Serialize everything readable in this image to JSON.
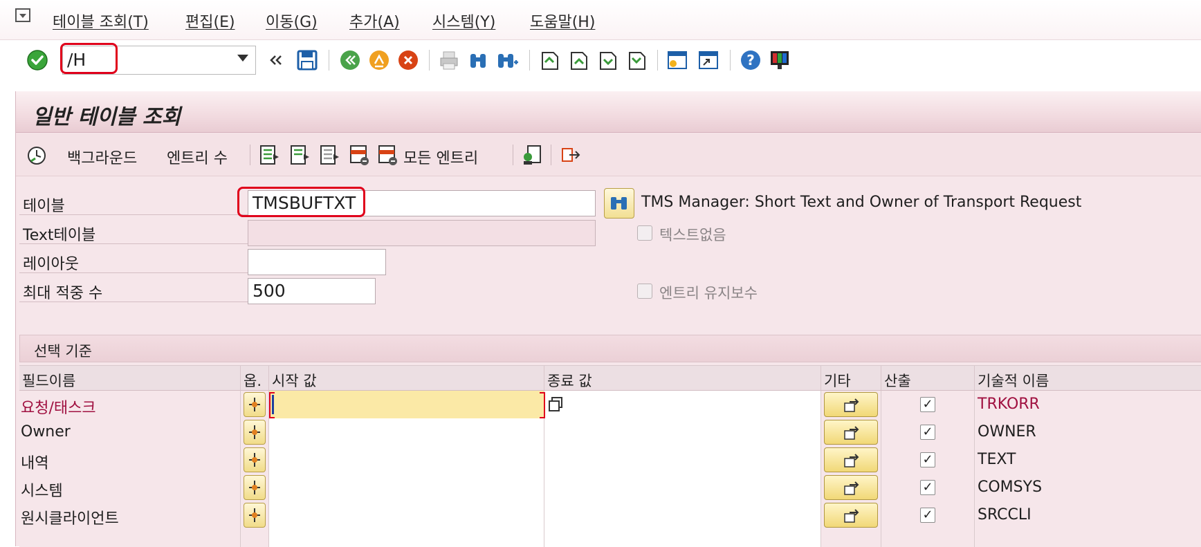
{
  "menu": {
    "items": [
      "테이블 조회(T)",
      "편집(E)",
      "이동(G)",
      "추가(A)",
      "시스템(Y)",
      "도움말(H)"
    ]
  },
  "toolbar": {
    "command_value": "/H",
    "icons": [
      "enter-icon",
      "back-double-icon",
      "save-icon",
      "back-icon",
      "exit-icon",
      "cancel-icon",
      "print-icon",
      "find-icon",
      "find-next-icon",
      "first-page-icon",
      "previous-page-icon",
      "next-page-icon",
      "last-page-icon",
      "create-session-icon",
      "shortcut-icon",
      "help-icon",
      "customize-layout-icon"
    ]
  },
  "page": {
    "title": "일반 테이블 조회"
  },
  "app_toolbar": {
    "background_label": "백그라운드",
    "entry_count_label": "엔트리 수",
    "all_entries_label": "모든 엔트리"
  },
  "form": {
    "table_label": "테이블",
    "table_value": "TMSBUFTXT",
    "table_description": "TMS Manager: Short Text and Owner of Transport Request",
    "text_table_label": "Text테이블",
    "text_table_value": "",
    "layout_label": "레이아웃",
    "layout_value": "",
    "max_hits_label": "최대 적중 수",
    "max_hits_value": "500",
    "no_text_label": "텍스트없음",
    "entry_maintenance_label": "엔트리 유지보수"
  },
  "selection": {
    "group_title": "선택 기준",
    "columns": [
      "필드이름",
      "옵.",
      "시작 값",
      "종료 값",
      "기타",
      "산출",
      "기술적 이름"
    ],
    "rows": [
      {
        "field": "요청/태스크",
        "from": "",
        "to": "",
        "output": "✓",
        "tech_name": "TRKORR"
      },
      {
        "field": "Owner",
        "from": "",
        "to": "",
        "output": "✓",
        "tech_name": "OWNER"
      },
      {
        "field": "내역",
        "from": "",
        "to": "",
        "output": "✓",
        "tech_name": "TEXT"
      },
      {
        "field": "시스템",
        "from": "",
        "to": "",
        "output": "✓",
        "tech_name": "COMSYS"
      },
      {
        "field": "원시클라이언트",
        "from": "",
        "to": "",
        "output": "✓",
        "tech_name": "SRCCLI"
      }
    ]
  },
  "colors": {
    "highlight_red": "#e0001b",
    "frame_pink": "#f6e6ea",
    "key_field_text": "#a01040",
    "active_input": "#fbe9a6"
  }
}
